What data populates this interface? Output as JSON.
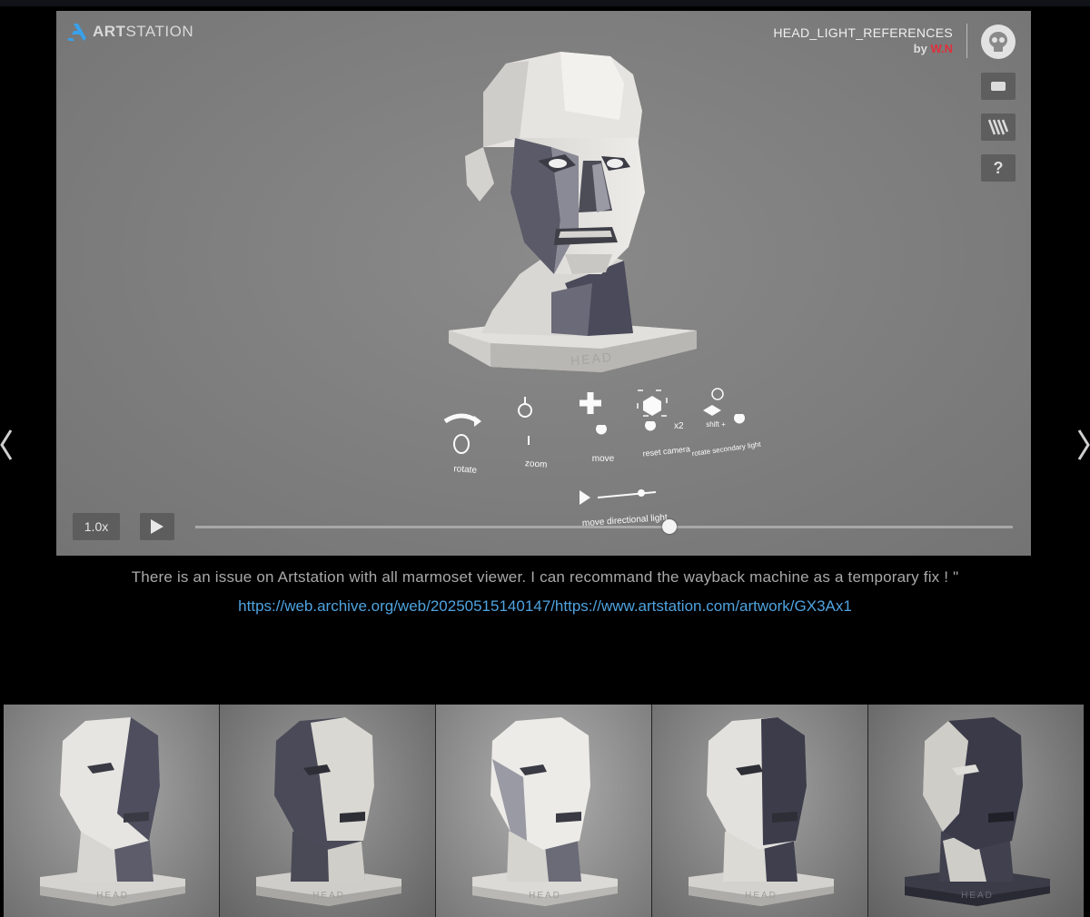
{
  "viewer": {
    "logo_text_bold": "ART",
    "logo_text_rest": "STATION",
    "title": "HEAD_LIGHT_REFERENCES",
    "by_prefix": "by",
    "author": "W.N",
    "help_label": "?",
    "base_label": "HEAD",
    "controls": {
      "rotate": "rotate",
      "zoom": "zoom",
      "move": "move",
      "reset_camera": "reset camera",
      "reset_multiplier": "x2",
      "secondary_light_shift": "shift +",
      "rotate_secondary_light": "rotate secondary light",
      "move_directional_light": "move directional light"
    },
    "playback": {
      "speed": "1.0x",
      "progress": 0.58
    }
  },
  "caption": {
    "text": "There is an issue on Artstation with all marmoset viewer. I can recommand the wayback machine as a temporary fix ! \"",
    "link": "https://web.archive.org/web/20250515140147/https://www.artstation.com/artwork/GX3Ax1"
  },
  "thumbnails": [
    {
      "base_label": "HEAD"
    },
    {
      "base_label": "HEAD"
    },
    {
      "base_label": "HEAD"
    },
    {
      "base_label": "HEAD"
    },
    {
      "base_label": "HEAD"
    }
  ],
  "colors": {
    "author": "#e0303c",
    "link": "#4fa3e0",
    "caption": "#a9a9a9"
  }
}
